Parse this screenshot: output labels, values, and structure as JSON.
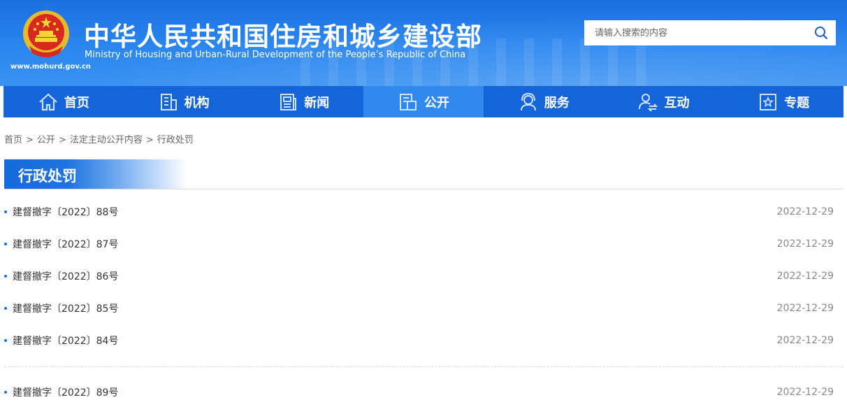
{
  "header": {
    "title_cn": "中华人民共和国住房和城乡建设部",
    "title_en": "Ministry of Housing and Urban-Rural Development of the People’s Republic of China",
    "site_url": "www.mohurd.gov.cn",
    "emblem_icon": "national-emblem-icon",
    "search": {
      "placeholder": "请输入搜索的内容",
      "value": "",
      "icon": "search-icon"
    }
  },
  "nav": {
    "items": [
      {
        "label": "首页",
        "icon": "home-icon"
      },
      {
        "label": "机构",
        "icon": "building-icon"
      },
      {
        "label": "新闻",
        "icon": "newspaper-icon"
      },
      {
        "label": "公开",
        "icon": "document-icon",
        "active": true
      },
      {
        "label": "服务",
        "icon": "service-agent-icon"
      },
      {
        "label": "互动",
        "icon": "user-exchange-icon"
      },
      {
        "label": "专题",
        "icon": "star-box-icon"
      }
    ]
  },
  "breadcrumb": {
    "items": [
      "首页",
      "公开",
      "法定主动公开内容",
      "行政处罚"
    ],
    "separator": ">"
  },
  "section": {
    "title": "行政处罚"
  },
  "list": {
    "group1": [
      {
        "title": "建督撤字〔2022〕88号",
        "date": "2022-12-29"
      },
      {
        "title": "建督撤字〔2022〕87号",
        "date": "2022-12-29"
      },
      {
        "title": "建督撤字〔2022〕86号",
        "date": "2022-12-29"
      },
      {
        "title": "建督撤字〔2022〕85号",
        "date": "2022-12-29"
      },
      {
        "title": "建督撤字〔2022〕84号",
        "date": "2022-12-29"
      }
    ],
    "group2": [
      {
        "title": "建督撤字〔2022〕89号",
        "date": "2022-12-29"
      }
    ]
  },
  "colors": {
    "primary": "#1565d8",
    "nav_active": "#3189ee",
    "header_bg": "#2a86ef",
    "bullet": "#1a6fe0",
    "date_text": "#888888"
  }
}
